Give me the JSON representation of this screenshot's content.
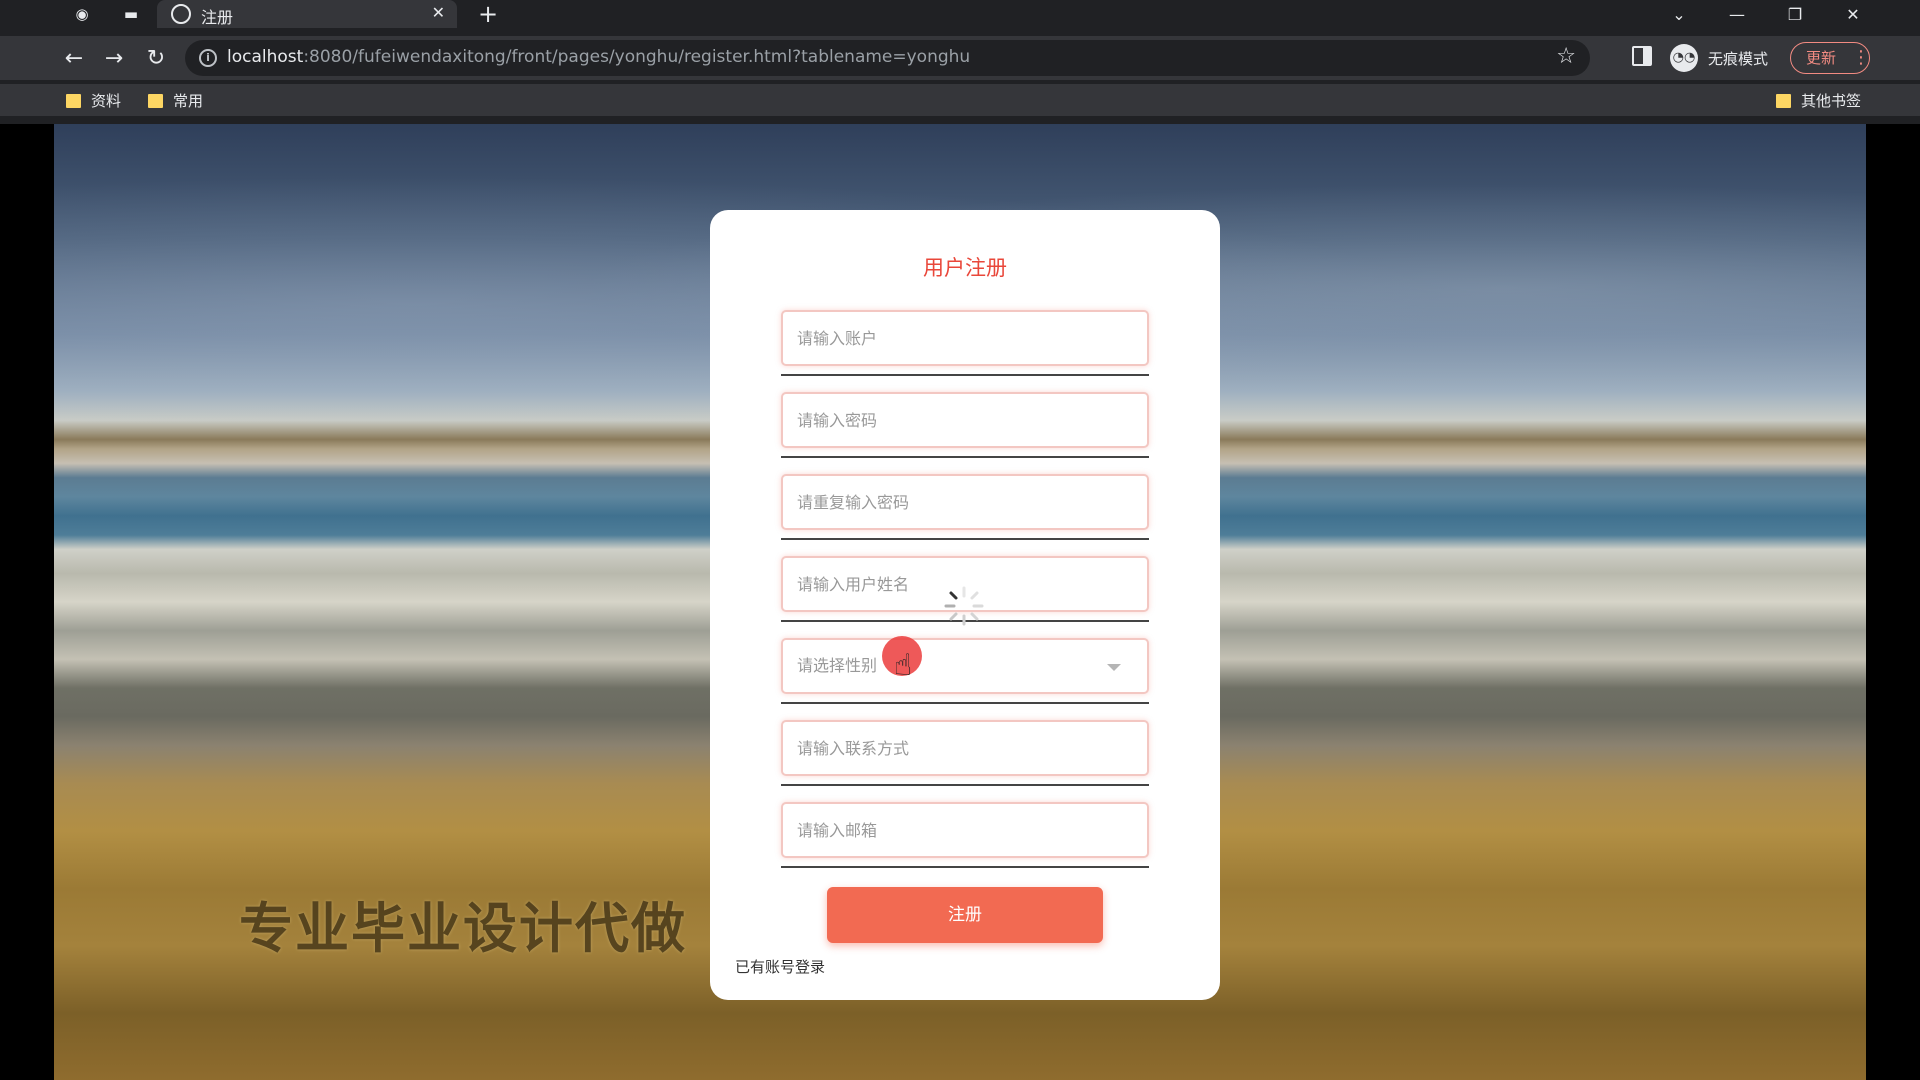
{
  "browser": {
    "tab_title": "注册",
    "url_host": "localhost",
    "url_rest": ":8080/fufeiwendaxitong/front/pages/yonghu/register.html?tablename=yonghu",
    "incognito_label": "无痕模式",
    "update_label": "更新",
    "bookmarks": [
      "资料",
      "常用"
    ],
    "other_bookmarks": "其他书签"
  },
  "page": {
    "watermark": "专业毕业设计代做"
  },
  "form": {
    "title": "用户注册",
    "fields": [
      {
        "placeholder": "请输入账户"
      },
      {
        "placeholder": "请输入密码"
      },
      {
        "placeholder": "请重复输入密码"
      },
      {
        "placeholder": "请输入用户姓名"
      },
      {
        "placeholder": "请选择性别"
      },
      {
        "placeholder": "请输入联系方式"
      },
      {
        "placeholder": "请输入邮箱"
      }
    ],
    "submit_label": "注册",
    "login_link": "已有账号登录"
  },
  "colors": {
    "accent": "#f26a52",
    "title_red": "#e9473a"
  }
}
